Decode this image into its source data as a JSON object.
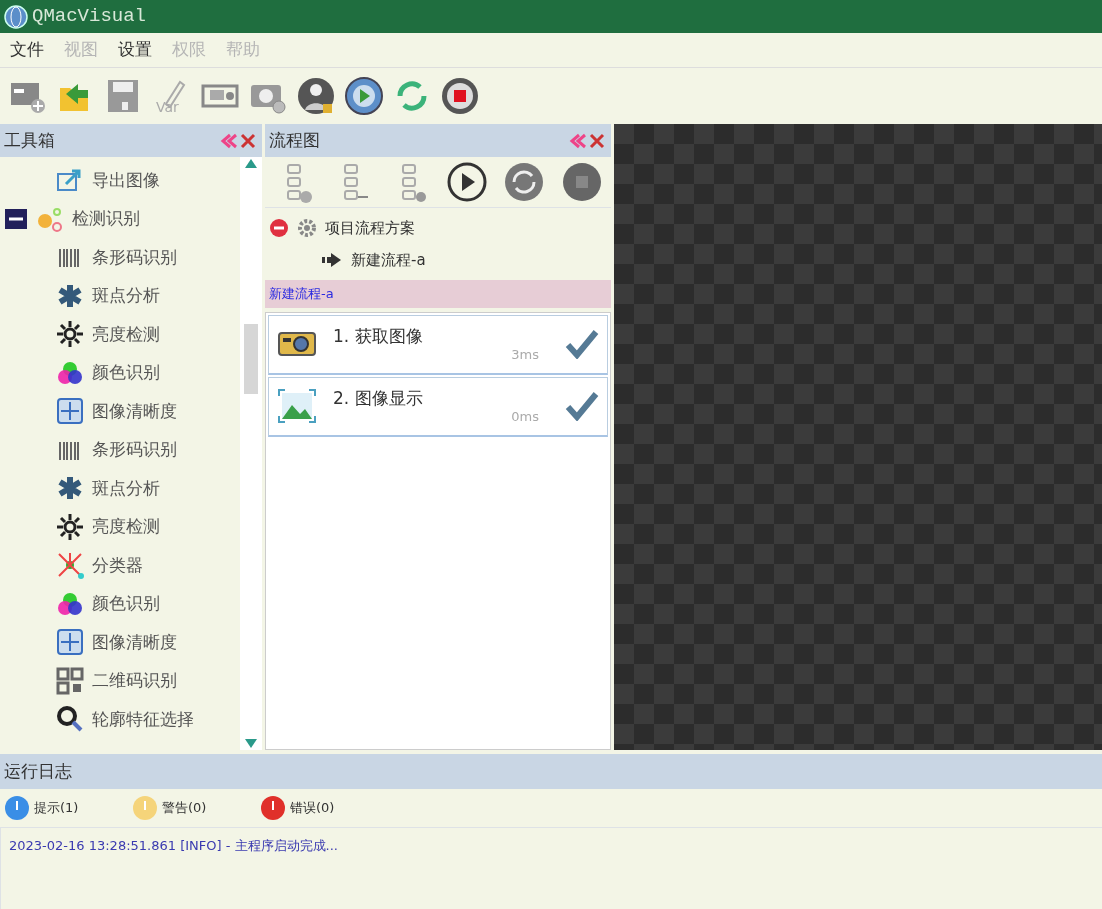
{
  "window": {
    "title": "QMacVisual"
  },
  "menu": [
    {
      "label": "文件",
      "disabled": false
    },
    {
      "label": "视图",
      "disabled": true
    },
    {
      "label": "设置",
      "disabled": false
    },
    {
      "label": "权限",
      "disabled": true
    },
    {
      "label": "帮助",
      "disabled": true
    }
  ],
  "toolbar": {
    "variable_label": "Var"
  },
  "toolbox": {
    "title": "工具箱",
    "tree": [
      {
        "children": [
          {
            "label": "导出图像",
            "kind": "export"
          }
        ]
      },
      {
        "label": "检测识别",
        "kind": "group",
        "expanded": true,
        "children": [
          {
            "label": "条形码识别",
            "kind": "barcode"
          },
          {
            "label": "斑点分析",
            "kind": "blob"
          },
          {
            "label": "亮度检测",
            "kind": "brightness"
          },
          {
            "label": "颜色识别",
            "kind": "color"
          },
          {
            "label": "图像清晰度",
            "kind": "sharpness"
          },
          {
            "label": "条形码识别",
            "kind": "barcode"
          },
          {
            "label": "斑点分析",
            "kind": "blob"
          },
          {
            "label": "亮度检测",
            "kind": "brightness"
          },
          {
            "label": "分类器",
            "kind": "classifier"
          },
          {
            "label": "颜色识别",
            "kind": "color"
          },
          {
            "label": "图像清晰度",
            "kind": "sharpness"
          },
          {
            "label": "二维码识别",
            "kind": "qrcode"
          },
          {
            "label": "轮廓特征选择",
            "kind": "contour"
          }
        ]
      }
    ]
  },
  "flow": {
    "title": "流程图",
    "tree": [
      {
        "label": "项目流程方案",
        "expanded": true,
        "children": [
          {
            "label": "新建流程-a"
          }
        ]
      }
    ],
    "current": "新建流程-a",
    "steps": [
      {
        "label": "1. 获取图像",
        "time": "3ms",
        "done": true,
        "kind": "camera"
      },
      {
        "label": "2. 图像显示",
        "time": "0ms",
        "done": true,
        "kind": "image"
      }
    ]
  },
  "log": {
    "title": "运行日志",
    "filters": [
      {
        "label": "提示(1)",
        "color": "#3a8ee6"
      },
      {
        "label": "警告(0)",
        "color": "#f5d47a"
      },
      {
        "label": "错误(0)",
        "color": "#e0302a"
      }
    ],
    "entries": [
      "2023-02-16 13:28:51.861 [INFO]  -  主程序启动完成..."
    ]
  }
}
